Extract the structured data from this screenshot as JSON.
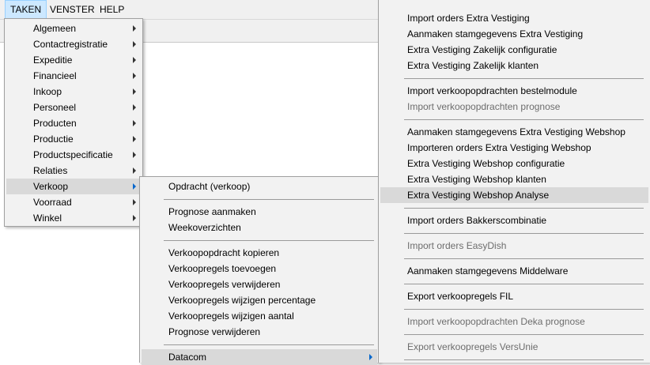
{
  "menubar": {
    "items": [
      {
        "label": "TAKEN"
      },
      {
        "label": "VENSTER"
      },
      {
        "label": "HELP"
      }
    ]
  },
  "taken_menu": {
    "items": [
      {
        "label": "Algemeen"
      },
      {
        "label": "Contactregistratie"
      },
      {
        "label": "Expeditie"
      },
      {
        "label": "Financieel"
      },
      {
        "label": "Inkoop"
      },
      {
        "label": "Personeel"
      },
      {
        "label": "Producten"
      },
      {
        "label": "Productie"
      },
      {
        "label": "Productspecificatie"
      },
      {
        "label": "Relaties"
      },
      {
        "label": "Verkoop"
      },
      {
        "label": "Voorraad"
      },
      {
        "label": "Winkel"
      }
    ]
  },
  "verkoop_menu": {
    "items": [
      {
        "label": "Opdracht (verkoop)"
      },
      {
        "label": "Prognose aanmaken"
      },
      {
        "label": "Weekoverzichten"
      },
      {
        "label": "Verkoopopdracht kopieren"
      },
      {
        "label": "Verkoopregels toevoegen"
      },
      {
        "label": "Verkoopregels verwijderen"
      },
      {
        "label": "Verkoopregels wijzigen percentage"
      },
      {
        "label": "Verkoopregels wijzigen aantal"
      },
      {
        "label": "Prognose verwijderen"
      },
      {
        "label": "Datacom"
      }
    ]
  },
  "datacom_menu": {
    "items": [
      {
        "label": "Import orders Extra Vestiging"
      },
      {
        "label": "Aanmaken stamgegevens Extra Vestiging"
      },
      {
        "label": "Extra Vestiging Zakelijk configuratie"
      },
      {
        "label": "Extra Vestiging Zakelijk klanten"
      },
      {
        "label": "Import verkoopopdrachten bestelmodule"
      },
      {
        "label": "Import verkoopopdrachten prognose"
      },
      {
        "label": "Aanmaken stamgegevens Extra Vestiging Webshop"
      },
      {
        "label": "Importeren orders Extra Vestiging Webshop"
      },
      {
        "label": "Extra Vestiging Webshop configuratie"
      },
      {
        "label": "Extra Vestiging Webshop klanten"
      },
      {
        "label": "Extra Vestiging Webshop Analyse"
      },
      {
        "label": "Import orders Bakkerscombinatie"
      },
      {
        "label": "Import orders EasyDish"
      },
      {
        "label": "Aanmaken stamgegevens Middelware"
      },
      {
        "label": "Export verkoopregels FIL"
      },
      {
        "label": "Import verkoopopdrachten Deka prognose"
      },
      {
        "label": "Export verkoopregels VersUnie"
      }
    ]
  }
}
